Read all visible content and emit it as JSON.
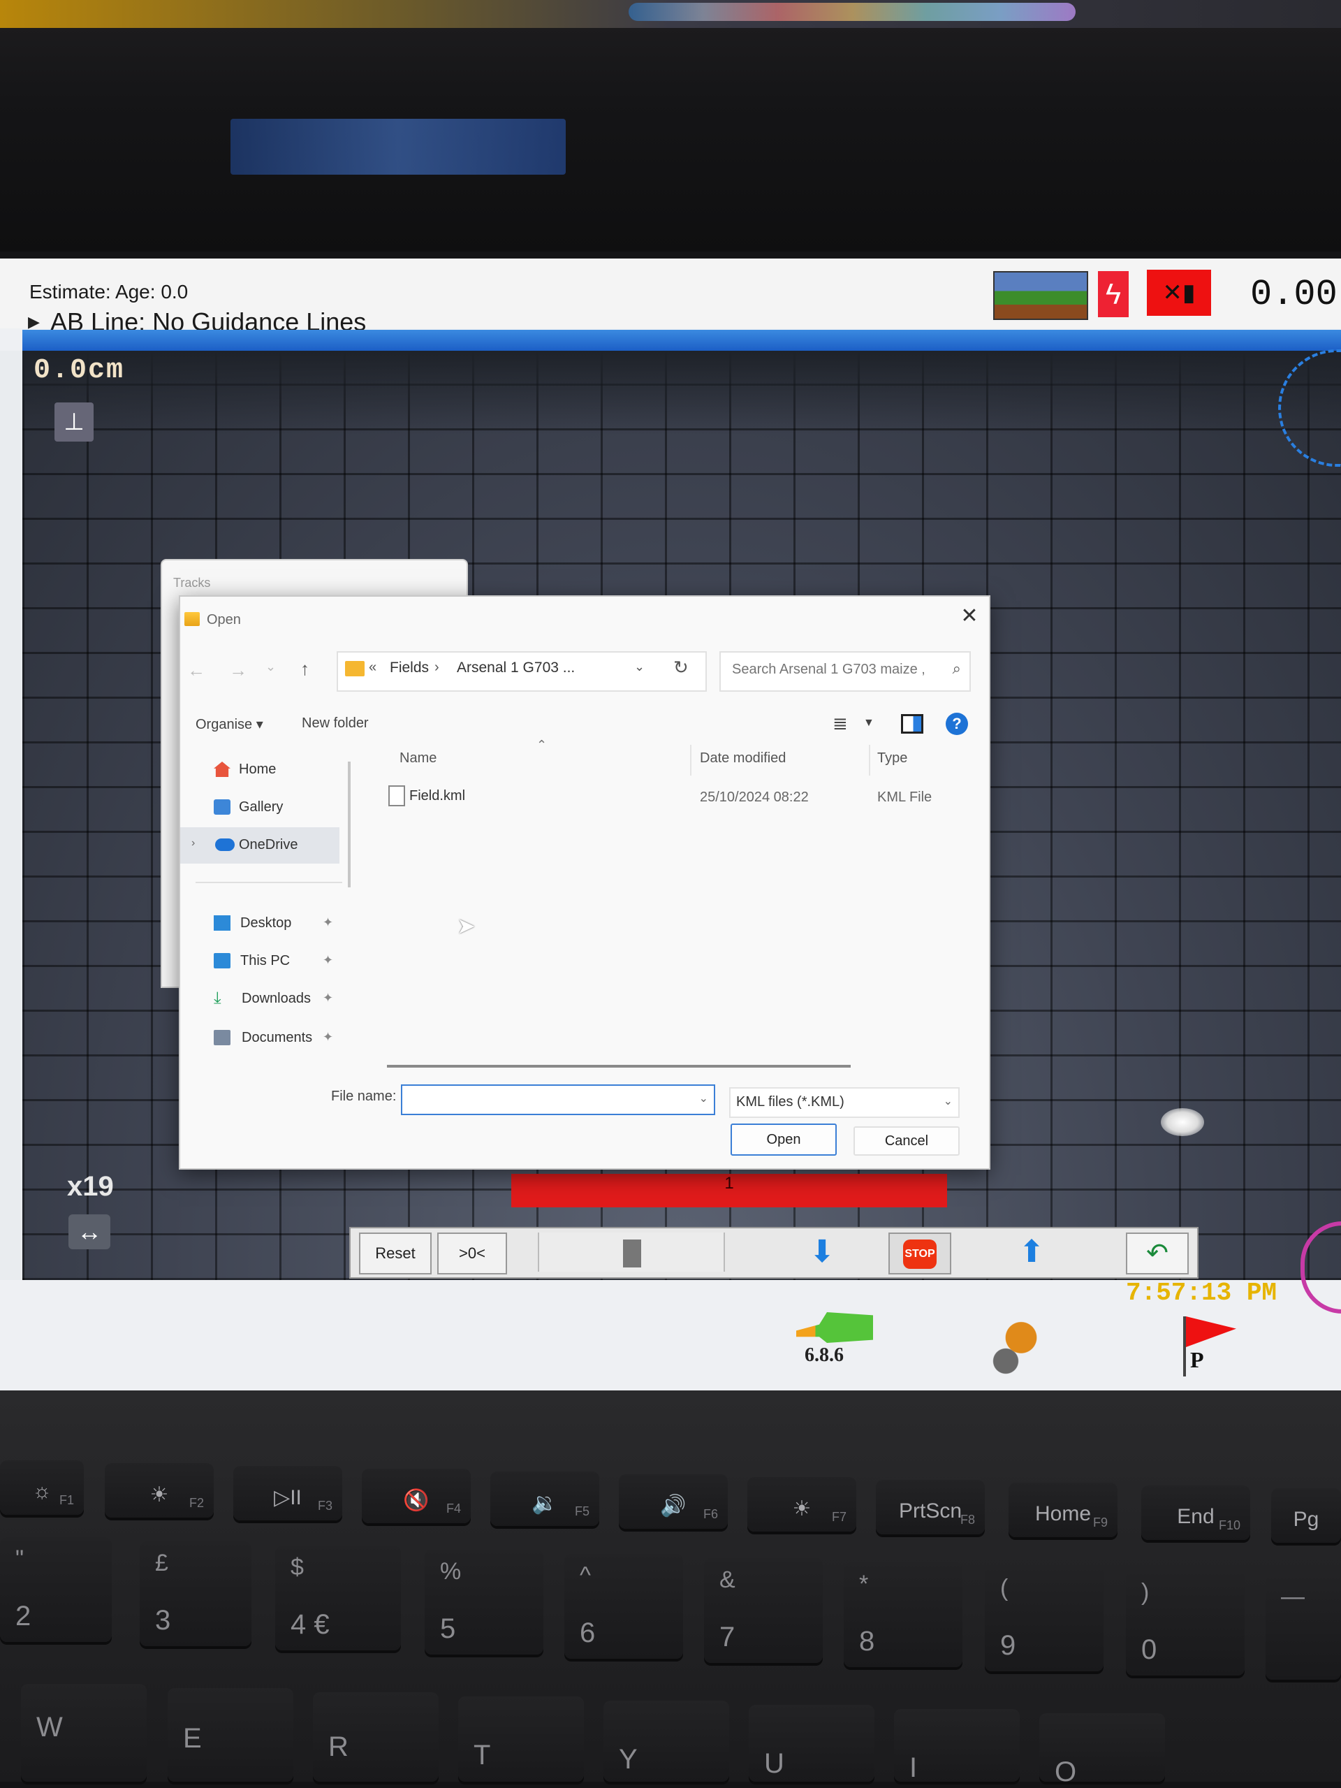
{
  "app": {
    "estimate": "Estimate: Age: 0.0",
    "ab_line": "AB Line: No Guidance Lines",
    "speed": "0.00",
    "offset": "0.0cm",
    "zoom": "x19",
    "clock": "7:57:13 PM",
    "version": "6.8.6",
    "flag_label": "P",
    "red_bar_value": "1",
    "toolbar": {
      "reset": "Reset",
      "center": ">0<",
      "stop": "STOP"
    },
    "icons": {
      "field": "field-landscape-icon",
      "power": "lightning-icon",
      "gps": "no-gps-signal-icon",
      "tool": "tool-offset-icon",
      "zoom": "horizontal-arrows-icon",
      "down": "arrow-down-icon",
      "up": "arrow-up-icon",
      "uturn": "u-turn-icon",
      "tractor": "tractor-uturn-icon",
      "flag": "red-flag-icon"
    }
  },
  "tracks_window": {
    "title": "Tracks"
  },
  "dialog": {
    "title": "Open",
    "close": "✕",
    "nav": {
      "back": "←",
      "forward": "→",
      "recent": "⌄",
      "up": "↑"
    },
    "address": {
      "prefix": "«",
      "crumbs": [
        "Fields",
        "Arsenal 1 G703 ..."
      ],
      "separator": "›"
    },
    "search_placeholder": "Search Arsenal 1 G703 maize ,",
    "toolbar": {
      "organise": "Organise ▾",
      "new_folder": "New folder"
    },
    "sidebar": [
      {
        "label": "Home"
      },
      {
        "label": "Gallery"
      },
      {
        "label": "OneDrive"
      },
      {
        "label": "Desktop"
      },
      {
        "label": "This PC"
      },
      {
        "label": "Downloads"
      },
      {
        "label": "Documents"
      }
    ],
    "columns": {
      "name": "Name",
      "date": "Date modified",
      "type": "Type"
    },
    "files": [
      {
        "name": "Field.kml",
        "date": "25/10/2024 08:22",
        "type": "KML File"
      }
    ],
    "file_name_label": "File name:",
    "file_name_value": "",
    "filter": "KML files (*.KML)",
    "open_button": "Open",
    "cancel_button": "Cancel"
  },
  "keyboard": {
    "fn_row": [
      {
        "glyph": "☼",
        "fn": "F1"
      },
      {
        "glyph": "☀",
        "fn": "F2"
      },
      {
        "glyph": "▷II",
        "fn": "F3"
      },
      {
        "glyph": "🔇",
        "fn": "F4"
      },
      {
        "glyph": "🔉",
        "fn": "F5"
      },
      {
        "glyph": "🔊",
        "fn": "F6"
      },
      {
        "glyph": "☀",
        "fn": "F7"
      },
      {
        "glyph": "PrtScn",
        "fn": "F8"
      },
      {
        "glyph": "Home",
        "fn": "F9"
      },
      {
        "glyph": "End",
        "fn": "F10"
      },
      {
        "glyph": "Pg",
        "fn": ""
      }
    ],
    "number_row": [
      {
        "top": "\"",
        "bot": "2"
      },
      {
        "top": "£",
        "bot": "3"
      },
      {
        "top": "$",
        "bot": "4 €"
      },
      {
        "top": "%",
        "bot": "5"
      },
      {
        "top": "^",
        "bot": "6"
      },
      {
        "top": "&",
        "bot": "7"
      },
      {
        "top": "*",
        "bot": "8"
      },
      {
        "top": "(",
        "bot": "9"
      },
      {
        "top": ")",
        "bot": "0"
      },
      {
        "top": "—",
        "bot": ""
      }
    ],
    "letter_row": [
      "W",
      "E",
      "R",
      "T",
      "Y",
      "U",
      "I",
      "O"
    ]
  }
}
